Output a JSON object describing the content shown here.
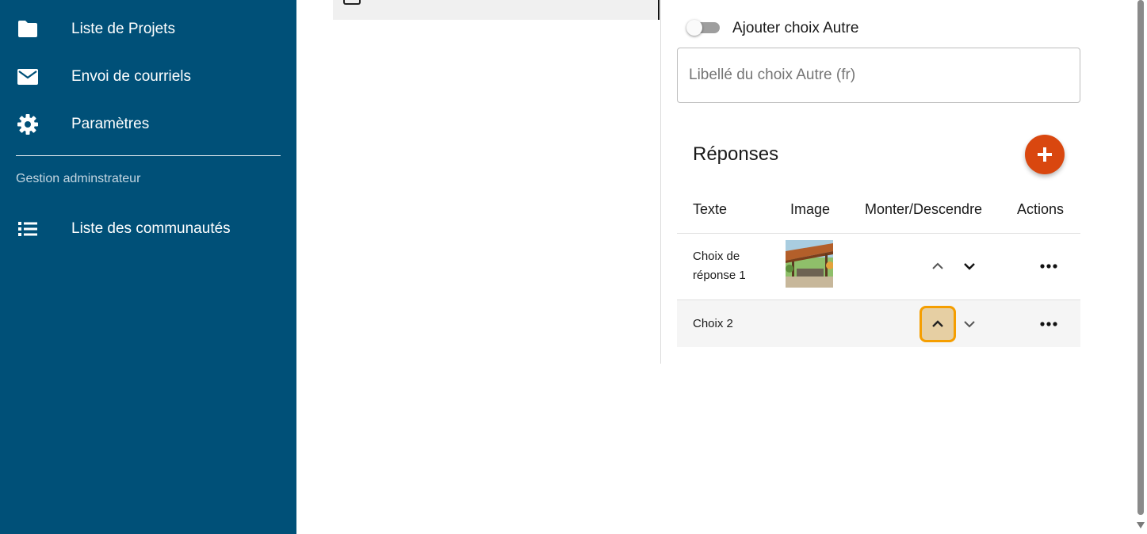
{
  "sidebar": {
    "items": [
      {
        "label": "Liste de Projets",
        "icon": "folder-icon"
      },
      {
        "label": "Envoi de courriels",
        "icon": "mail-icon"
      },
      {
        "label": "Paramètres",
        "icon": "gear-icon"
      }
    ],
    "section_label": "Gestion adminstrateur",
    "admin_items": [
      {
        "label": "Liste des communautés",
        "icon": "list-icon"
      }
    ],
    "background": "#005078"
  },
  "other_choice": {
    "toggle_label": "Ajouter choix Autre",
    "toggle_on": false,
    "input_placeholder": "Libellé du choix Autre (fr)",
    "input_value": ""
  },
  "responses": {
    "title": "Réponses",
    "add_button_color": "#d9470f",
    "columns": [
      "Texte",
      "Image",
      "Monter/Descendre",
      "Actions"
    ],
    "rows": [
      {
        "text": "Choix de réponse 1",
        "has_image": true
      },
      {
        "text": "Choix 2",
        "has_image": false
      }
    ]
  },
  "colors": {
    "highlight_border": "#f59e00",
    "highlight_fill": "#e6cfa3"
  }
}
